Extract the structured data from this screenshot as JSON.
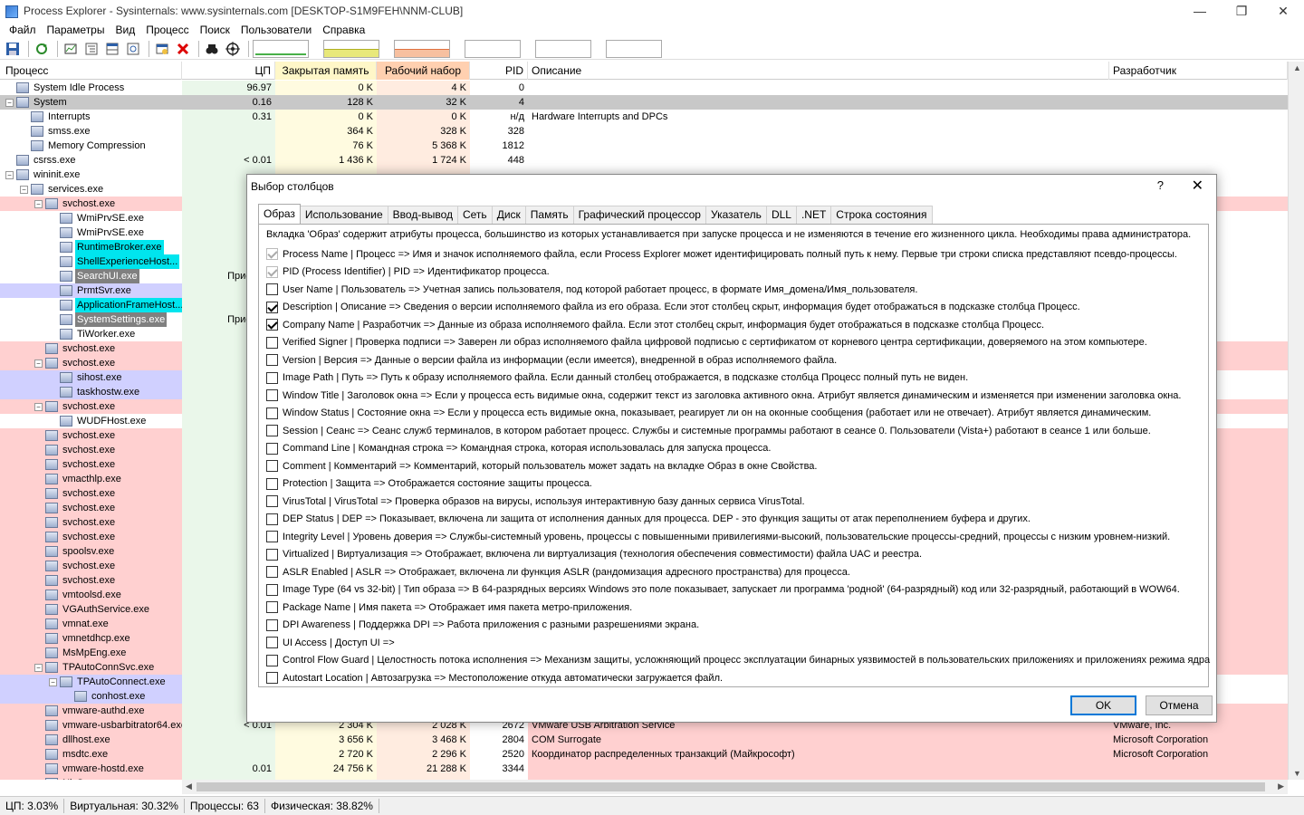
{
  "window": {
    "title": "Process Explorer - Sysinternals: www.sysinternals.com [DESKTOP-S1M9FEH\\NNM-CLUB]",
    "minimize": "—",
    "restore": "❐",
    "close": "✕"
  },
  "menu": [
    "Файл",
    "Параметры",
    "Вид",
    "Процесс",
    "Поиск",
    "Пользователи",
    "Справка"
  ],
  "toolbar": {
    "icons": [
      "save-icon",
      "refresh-icon",
      "system-info-icon",
      "process-tree-icon",
      "lower-pane-icon",
      "properties-icon",
      "find-window-icon",
      "kill-process-icon",
      "find-handle-icon",
      "target-icon"
    ]
  },
  "columns": {
    "process": "Процесс",
    "cpu": "ЦП",
    "private": "Закрытая память",
    "working": "Рабочий набор",
    "pid": "PID",
    "description": "Описание",
    "company": "Разработчик"
  },
  "processes": [
    {
      "name": "System Idle Process",
      "level": 0,
      "exp": "",
      "cpu": "96.97",
      "priv": "0 K",
      "work": "4 K",
      "pid": "0",
      "desc": "",
      "comp": "",
      "style": ""
    },
    {
      "name": "System",
      "level": 0,
      "exp": "−",
      "cpu": "0.16",
      "priv": "128 K",
      "work": "32 K",
      "pid": "4",
      "desc": "",
      "comp": "",
      "style": "gray"
    },
    {
      "name": "Interrupts",
      "level": 1,
      "exp": "",
      "cpu": "0.31",
      "priv": "0 K",
      "work": "0 K",
      "pid": "н/д",
      "desc": "Hardware Interrupts and DPCs",
      "comp": "",
      "style": ""
    },
    {
      "name": "smss.exe",
      "level": 1,
      "exp": "",
      "cpu": "",
      "priv": "364 K",
      "work": "328 K",
      "pid": "328",
      "desc": "",
      "comp": "",
      "style": ""
    },
    {
      "name": "Memory Compression",
      "level": 1,
      "exp": "",
      "cpu": "",
      "priv": "76 K",
      "work": "5 368 K",
      "pid": "1812",
      "desc": "",
      "comp": "",
      "style": ""
    },
    {
      "name": "csrss.exe",
      "level": 0,
      "exp": "",
      "cpu": "< 0.01",
      "priv": "1 436 K",
      "work": "1 724 K",
      "pid": "448",
      "desc": "",
      "comp": "",
      "style": ""
    },
    {
      "name": "wininit.exe",
      "level": 0,
      "exp": "−",
      "cpu": "",
      "priv": "",
      "work": "",
      "pid": "",
      "desc": "",
      "comp": "",
      "style": ""
    },
    {
      "name": "services.exe",
      "level": 1,
      "exp": "−",
      "cpu": "",
      "priv": "",
      "work": "",
      "pid": "",
      "desc": "",
      "comp": "",
      "style": ""
    },
    {
      "name": "svchost.exe",
      "level": 2,
      "exp": "−",
      "cpu": "",
      "priv": "",
      "work": "",
      "pid": "",
      "desc": "",
      "comp": "",
      "style": "pink"
    },
    {
      "name": "WmiPrvSE.exe",
      "level": 3,
      "exp": "",
      "cpu": "",
      "priv": "",
      "work": "",
      "pid": "",
      "desc": "",
      "comp": "",
      "style": ""
    },
    {
      "name": "WmiPrvSE.exe",
      "level": 3,
      "exp": "",
      "cpu": "",
      "priv": "",
      "work": "",
      "pid": "",
      "desc": "",
      "comp": "",
      "style": ""
    },
    {
      "name": "RuntimeBroker.exe",
      "level": 3,
      "exp": "",
      "cpu": "",
      "priv": "",
      "work": "",
      "pid": "",
      "desc": "",
      "comp": "",
      "style": "cyan"
    },
    {
      "name": "ShellExperienceHost...",
      "level": 3,
      "exp": "",
      "cpu": "",
      "priv": "",
      "work": "",
      "pid": "",
      "desc": "",
      "comp": "",
      "style": "cyan"
    },
    {
      "name": "SearchUI.exe",
      "level": 3,
      "exp": "",
      "cpu": "Приостан",
      "priv": "",
      "work": "",
      "pid": "",
      "desc": "",
      "comp": "",
      "style": "dgray"
    },
    {
      "name": "PrmtSvr.exe",
      "level": 3,
      "exp": "",
      "cpu": "",
      "priv": "",
      "work": "",
      "pid": "",
      "desc": "",
      "comp": "",
      "style": "blue"
    },
    {
      "name": "ApplicationFrameHost...",
      "level": 3,
      "exp": "",
      "cpu": "",
      "priv": "",
      "work": "",
      "pid": "",
      "desc": "",
      "comp": "",
      "style": "cyan"
    },
    {
      "name": "SystemSettings.exe",
      "level": 3,
      "exp": "",
      "cpu": "Приостан",
      "priv": "",
      "work": "",
      "pid": "",
      "desc": "",
      "comp": "",
      "style": "dgray"
    },
    {
      "name": "TiWorker.exe",
      "level": 3,
      "exp": "",
      "cpu": "",
      "priv": "",
      "work": "",
      "pid": "",
      "desc": "",
      "comp": "",
      "style": ""
    },
    {
      "name": "svchost.exe",
      "level": 2,
      "exp": "",
      "cpu": "",
      "priv": "",
      "work": "",
      "pid": "",
      "desc": "",
      "comp": "",
      "style": "pink"
    },
    {
      "name": "svchost.exe",
      "level": 2,
      "exp": "−",
      "cpu": "",
      "priv": "",
      "work": "",
      "pid": "",
      "desc": "",
      "comp": "",
      "style": "pink"
    },
    {
      "name": "sihost.exe",
      "level": 3,
      "exp": "",
      "cpu": "",
      "priv": "",
      "work": "",
      "pid": "",
      "desc": "",
      "comp": "",
      "style": "blue"
    },
    {
      "name": "taskhostw.exe",
      "level": 3,
      "exp": "",
      "cpu": "",
      "priv": "",
      "work": "",
      "pid": "",
      "desc": "",
      "comp": "",
      "style": "blue"
    },
    {
      "name": "svchost.exe",
      "level": 2,
      "exp": "−",
      "cpu": "",
      "priv": "",
      "work": "",
      "pid": "",
      "desc": "",
      "comp": "",
      "style": "pink"
    },
    {
      "name": "WUDFHost.exe",
      "level": 3,
      "exp": "",
      "cpu": "",
      "priv": "",
      "work": "",
      "pid": "",
      "desc": "",
      "comp": "",
      "style": ""
    },
    {
      "name": "svchost.exe",
      "level": 2,
      "exp": "",
      "cpu": "",
      "priv": "",
      "work": "",
      "pid": "",
      "desc": "",
      "comp": "",
      "style": "pink"
    },
    {
      "name": "svchost.exe",
      "level": 2,
      "exp": "",
      "cpu": "",
      "priv": "",
      "work": "",
      "pid": "",
      "desc": "",
      "comp": "",
      "style": "pink"
    },
    {
      "name": "svchost.exe",
      "level": 2,
      "exp": "",
      "cpu": "",
      "priv": "",
      "work": "",
      "pid": "",
      "desc": "",
      "comp": "",
      "style": "pink"
    },
    {
      "name": "vmacthlp.exe",
      "level": 2,
      "exp": "",
      "cpu": "",
      "priv": "",
      "work": "",
      "pid": "",
      "desc": "",
      "comp": "",
      "style": "pink"
    },
    {
      "name": "svchost.exe",
      "level": 2,
      "exp": "",
      "cpu": "",
      "priv": "",
      "work": "",
      "pid": "",
      "desc": "",
      "comp": "",
      "style": "pink"
    },
    {
      "name": "svchost.exe",
      "level": 2,
      "exp": "",
      "cpu": "",
      "priv": "",
      "work": "",
      "pid": "",
      "desc": "",
      "comp": "",
      "style": "pink"
    },
    {
      "name": "svchost.exe",
      "level": 2,
      "exp": "",
      "cpu": "",
      "priv": "",
      "work": "",
      "pid": "",
      "desc": "",
      "comp": "",
      "style": "pink"
    },
    {
      "name": "svchost.exe",
      "level": 2,
      "exp": "",
      "cpu": "",
      "priv": "",
      "work": "",
      "pid": "",
      "desc": "",
      "comp": "",
      "style": "pink"
    },
    {
      "name": "spoolsv.exe",
      "level": 2,
      "exp": "",
      "cpu": "",
      "priv": "",
      "work": "",
      "pid": "",
      "desc": "",
      "comp": "",
      "style": "pink"
    },
    {
      "name": "svchost.exe",
      "level": 2,
      "exp": "",
      "cpu": "",
      "priv": "",
      "work": "",
      "pid": "",
      "desc": "",
      "comp": "",
      "style": "pink"
    },
    {
      "name": "svchost.exe",
      "level": 2,
      "exp": "",
      "cpu": "",
      "priv": "",
      "work": "",
      "pid": "",
      "desc": "",
      "comp": "",
      "style": "pink"
    },
    {
      "name": "vmtoolsd.exe",
      "level": 2,
      "exp": "",
      "cpu": "",
      "priv": "",
      "work": "",
      "pid": "",
      "desc": "",
      "comp": "",
      "style": "pink"
    },
    {
      "name": "VGAuthService.exe",
      "level": 2,
      "exp": "",
      "cpu": "",
      "priv": "",
      "work": "",
      "pid": "",
      "desc": "",
      "comp": "",
      "style": "pink"
    },
    {
      "name": "vmnat.exe",
      "level": 2,
      "exp": "",
      "cpu": "",
      "priv": "",
      "work": "",
      "pid": "",
      "desc": "",
      "comp": "",
      "style": "pink"
    },
    {
      "name": "vmnetdhcp.exe",
      "level": 2,
      "exp": "",
      "cpu": "",
      "priv": "",
      "work": "",
      "pid": "",
      "desc": "",
      "comp": "",
      "style": "pink"
    },
    {
      "name": "MsMpEng.exe",
      "level": 2,
      "exp": "",
      "cpu": "",
      "priv": "",
      "work": "",
      "pid": "",
      "desc": "",
      "comp": "",
      "style": "pink"
    },
    {
      "name": "TPAutoConnSvc.exe",
      "level": 2,
      "exp": "−",
      "cpu": "",
      "priv": "",
      "work": "",
      "pid": "",
      "desc": "",
      "comp": "",
      "style": "pink"
    },
    {
      "name": "TPAutoConnect.exe",
      "level": 3,
      "exp": "−",
      "cpu": "",
      "priv": "",
      "work": "",
      "pid": "",
      "desc": "",
      "comp": "",
      "style": "blue"
    },
    {
      "name": "conhost.exe",
      "level": 4,
      "exp": "",
      "cpu": "",
      "priv": "",
      "work": "",
      "pid": "",
      "desc": "",
      "comp": "",
      "style": "blue"
    },
    {
      "name": "vmware-authd.exe",
      "level": 2,
      "exp": "",
      "cpu": "",
      "priv": "",
      "work": "",
      "pid": "",
      "desc": "",
      "comp": "",
      "style": "pink"
    },
    {
      "name": "vmware-usbarbitrator64.exe",
      "level": 2,
      "exp": "",
      "cpu": "< 0.01",
      "priv": "2 304 K",
      "work": "2 028 K",
      "pid": "2672",
      "desc": "VMware USB Arbitration Service",
      "comp": "VMware, Inc.",
      "style": "pink"
    },
    {
      "name": "dllhost.exe",
      "level": 2,
      "exp": "",
      "cpu": "",
      "priv": "3 656 K",
      "work": "3 468 K",
      "pid": "2804",
      "desc": "COM Surrogate",
      "comp": "Microsoft Corporation",
      "style": "pink"
    },
    {
      "name": "msdtc.exe",
      "level": 2,
      "exp": "",
      "cpu": "",
      "priv": "2 720 K",
      "work": "2 296 K",
      "pid": "2520",
      "desc": "Координатор распределенных транзакций (Майкрософт)",
      "comp": "Microsoft Corporation",
      "style": "pink"
    },
    {
      "name": "vmware-hostd.exe",
      "level": 2,
      "exp": "",
      "cpu": "0.01",
      "priv": "24 756 K",
      "work": "21 288 K",
      "pid": "3344",
      "desc": "",
      "comp": "",
      "style": "pink"
    },
    {
      "name": "NisSrv.exe",
      "level": 2,
      "exp": "",
      "cpu": "",
      "priv": "",
      "work": "",
      "pid": "",
      "desc": "",
      "comp": "",
      "style": "pink"
    }
  ],
  "status": {
    "cpu": "ЦП: 3.03%",
    "virtual": "Виртуальная: 30.32%",
    "processes": "Процессы: 63",
    "physical": "Физическая: 38.82%"
  },
  "dialog": {
    "title": "Выбор столбцов",
    "help": "?",
    "close": "✕",
    "tabs": [
      "Образ",
      "Использование",
      "Ввод-вывод",
      "Сеть",
      "Диск",
      "Память",
      "Графический процессор",
      "Указатель",
      "DLL",
      ".NET",
      "Строка состояния"
    ],
    "active_tab": 0,
    "intro": "Вкладка 'Образ' содержит атрибуты процесса, большинство из которых устанавливается при запуске процесса и не изменяются в течение его жизненного цикла. Необходимы права администратора.",
    "options": [
      {
        "label": "Process Name | Процесс => Имя и значок исполняемого файла, если Process Explorer может идентифицировать полный путь к нему. Первые три строки списка представляют псевдо-процессы.",
        "checked": true,
        "disabled": true
      },
      {
        "label": "PID (Process Identifier) | PID => Идентификатор процесса.",
        "checked": true,
        "disabled": true
      },
      {
        "label": "User Name | Пользователь => Учетная запись пользователя, под которой работает процесс, в формате Имя_домена/Имя_пользователя.",
        "checked": false,
        "disabled": false
      },
      {
        "label": "Description | Описание => Сведения о версии исполняемого файла из его образа. Если этот столбец скрыт, информация будет отображаться в подсказке столбца Процесс.",
        "checked": true,
        "disabled": false
      },
      {
        "label": "Company Name | Разработчик => Данные из образа исполняемого файла. Если этот столбец скрыт, информация будет отображаться в подсказке столбца Процесс.",
        "checked": true,
        "disabled": false
      },
      {
        "label": "Verified Signer | Проверка подписи => Заверен ли образ исполняемого файла цифровой подписью с сертификатом от корневого центра сертификации, доверяемого на этом компьютере.",
        "checked": false,
        "disabled": false
      },
      {
        "label": "Version | Версия => Данные о версии файла из информации (если имеется), внедренной в образ исполняемого файла.",
        "checked": false,
        "disabled": false
      },
      {
        "label": "Image Path | Путь => Путь к образу исполняемого файла. Если данный столбец отображается, в подсказке столбца Процесс полный путь не виден.",
        "checked": false,
        "disabled": false
      },
      {
        "label": "Window Title | Заголовок окна => Если у процесса есть видимые окна, содержит текст из заголовка активного окна. Атрибут является динамическим и изменяется при изменении заголовка окна.",
        "checked": false,
        "disabled": false
      },
      {
        "label": "Window Status | Состояние окна => Если у процесса есть видимые окна, показывает, реагирует ли он на оконные сообщения (работает или не отвечает). Атрибут является динамическим.",
        "checked": false,
        "disabled": false
      },
      {
        "label": "Session | Сеанс => Сеанс служб терминалов, в котором работает процесс. Службы и системные программы работают в сеансе 0. Пользователи (Vista+) работают в сеансе 1 или больше.",
        "checked": false,
        "disabled": false
      },
      {
        "label": "Command Line | Командная строка => Командная строка, которая использовалась для запуска процесса.",
        "checked": false,
        "disabled": false
      },
      {
        "label": "Comment | Комментарий => Комментарий, который пользователь может задать на вкладке Образ в окне Свойства.",
        "checked": false,
        "disabled": false
      },
      {
        "label": "Protection | Защита => Отображается состояние защиты процесса.",
        "checked": false,
        "disabled": false
      },
      {
        "label": "VirusTotal | VirusTotal => Проверка образов на вирусы, используя интерактивную базу данных сервиса VirusTotal.",
        "checked": false,
        "disabled": false
      },
      {
        "label": "DEP Status | DEP => Показывает, включена ли защита от исполнения данных для процесса. DEP - это функция защиты от атак переполнением буфера и других.",
        "checked": false,
        "disabled": false
      },
      {
        "label": "Integrity Level | Уровень доверия => Службы-системный уровень, процессы с повышенными привилегиями-высокий, пользовательские процессы-средний, процессы с низким уровнем-низкий.",
        "checked": false,
        "disabled": false
      },
      {
        "label": "Virtualized | Виртуализация => Отображает, включена ли виртуализация (технология обеспечения совместимости) файла UAC и реестра.",
        "checked": false,
        "disabled": false
      },
      {
        "label": "ASLR Enabled | ASLR => Отображает, включена ли функция ASLR (рандомизация адресного пространства) для процесса.",
        "checked": false,
        "disabled": false
      },
      {
        "label": "Image Type (64 vs 32-bit) | Тип образа => В 64-разрядных версиях Windows это поле показывает, запускает ли программа 'родной' (64-разрядный) код или 32-разрядный, работающий в WOW64.",
        "checked": false,
        "disabled": false
      },
      {
        "label": "Package Name | Имя пакета => Отображает имя пакета метро-приложения.",
        "checked": false,
        "disabled": false
      },
      {
        "label": "DPI Awareness | Поддержка DPI => Работа приложения с разными разрешениями экрана.",
        "checked": false,
        "disabled": false
      },
      {
        "label": "UI Access | Доступ UI =>",
        "checked": false,
        "disabled": false
      },
      {
        "label": "Control Flow Guard | Целостность потока исполнения => Механизм защиты, усложняющий процесс эксплуатации бинарных уязвимостей в пользовательских приложениях и приложениях режима ядра",
        "checked": false,
        "disabled": false
      },
      {
        "label": "Autostart Location | Автозагрузка => Местоположение откуда автоматически загружается файл.",
        "checked": false,
        "disabled": false
      }
    ],
    "ok": "OK",
    "cancel": "Отмена"
  }
}
